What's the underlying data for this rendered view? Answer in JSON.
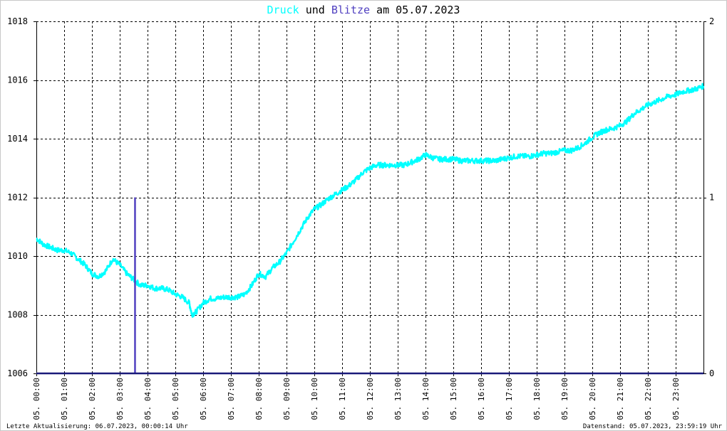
{
  "chart_data": {
    "type": "line",
    "title": {
      "part1": "Druck",
      "part2": " und ",
      "part3": "Blitze",
      "part4": " am 05.07.2023"
    },
    "colors": {
      "druck": "#00ffff",
      "blitze": "#5040c0",
      "baseline": "#1a1a7a",
      "title_text": "#000000",
      "grid": "#000000"
    },
    "y_left": {
      "min": 1006,
      "max": 1018,
      "ticks": [
        "1006",
        "1008",
        "1010",
        "1012",
        "1014",
        "1016",
        "1018"
      ]
    },
    "y_right": {
      "min": 0,
      "max": 2,
      "ticks": [
        "0",
        "1",
        "2"
      ]
    },
    "x": {
      "min_hour": 0,
      "max_hour": 24,
      "ticks": [
        "05. 00:00",
        "05. 01:00",
        "05. 02:00",
        "05. 03:00",
        "05. 04:00",
        "05. 05:00",
        "05. 06:00",
        "05. 07:00",
        "05. 08:00",
        "05. 09:00",
        "05. 10:00",
        "05. 11:00",
        "05. 12:00",
        "05. 13:00",
        "05. 14:00",
        "05. 15:00",
        "05. 16:00",
        "05. 17:00",
        "05. 18:00",
        "05. 19:00",
        "05. 20:00",
        "05. 21:00",
        "05. 22:00",
        "05. 23:00"
      ]
    },
    "grid": true,
    "series": [
      {
        "name": "Druck",
        "axis": "left",
        "hours": [
          0.0,
          0.25,
          0.5,
          0.75,
          1.0,
          1.25,
          1.5,
          1.75,
          2.0,
          2.25,
          2.5,
          2.75,
          3.0,
          3.25,
          3.5,
          3.75,
          4.0,
          4.25,
          4.5,
          4.75,
          5.0,
          5.25,
          5.5,
          5.6,
          5.75,
          6.0,
          6.25,
          6.5,
          6.75,
          7.0,
          7.25,
          7.5,
          7.75,
          8.0,
          8.25,
          8.5,
          8.75,
          9.0,
          9.25,
          9.5,
          9.75,
          10.0,
          10.25,
          10.5,
          10.75,
          11.0,
          11.25,
          11.5,
          11.75,
          12.0,
          12.25,
          12.5,
          12.75,
          13.0,
          13.25,
          13.5,
          13.75,
          14.0,
          14.25,
          14.5,
          14.75,
          15.0,
          15.25,
          15.5,
          15.75,
          16.0,
          16.25,
          16.5,
          16.75,
          17.0,
          17.25,
          17.5,
          17.75,
          18.0,
          18.25,
          18.5,
          18.75,
          19.0,
          19.25,
          19.5,
          19.75,
          20.0,
          20.25,
          20.5,
          20.75,
          21.0,
          21.25,
          21.5,
          21.75,
          22.0,
          22.25,
          22.5,
          22.75,
          23.0,
          23.25,
          23.5,
          23.75,
          24.0
        ],
        "values": [
          1010.6,
          1010.4,
          1010.3,
          1010.2,
          1010.2,
          1010.1,
          1009.9,
          1009.7,
          1009.4,
          1009.3,
          1009.5,
          1009.9,
          1009.7,
          1009.4,
          1009.2,
          1009.0,
          1009.0,
          1008.9,
          1008.9,
          1008.85,
          1008.7,
          1008.6,
          1008.4,
          1008.0,
          1008.1,
          1008.4,
          1008.55,
          1008.55,
          1008.6,
          1008.6,
          1008.6,
          1008.7,
          1009.0,
          1009.4,
          1009.3,
          1009.6,
          1009.8,
          1010.1,
          1010.5,
          1010.9,
          1011.3,
          1011.6,
          1011.75,
          1011.95,
          1012.1,
          1012.25,
          1012.4,
          1012.6,
          1012.85,
          1013.0,
          1013.1,
          1013.1,
          1013.1,
          1013.1,
          1013.1,
          1013.2,
          1013.3,
          1013.45,
          1013.35,
          1013.3,
          1013.3,
          1013.3,
          1013.25,
          1013.25,
          1013.25,
          1013.25,
          1013.25,
          1013.25,
          1013.3,
          1013.35,
          1013.4,
          1013.4,
          1013.4,
          1013.45,
          1013.5,
          1013.5,
          1013.55,
          1013.6,
          1013.6,
          1013.7,
          1013.85,
          1014.05,
          1014.2,
          1014.3,
          1014.35,
          1014.45,
          1014.6,
          1014.85,
          1015.0,
          1015.15,
          1015.25,
          1015.35,
          1015.45,
          1015.5,
          1015.6,
          1015.65,
          1015.7,
          1015.8
        ]
      },
      {
        "name": "Blitze",
        "axis": "right",
        "events": [
          {
            "hour": 3.55,
            "count": 1
          }
        ]
      }
    ]
  },
  "footer": {
    "left": "Letzte Aktualisierung: 06.07.2023, 00:00:14 Uhr",
    "right": "Datenstand: 05.07.2023, 23:59:19 Uhr"
  }
}
